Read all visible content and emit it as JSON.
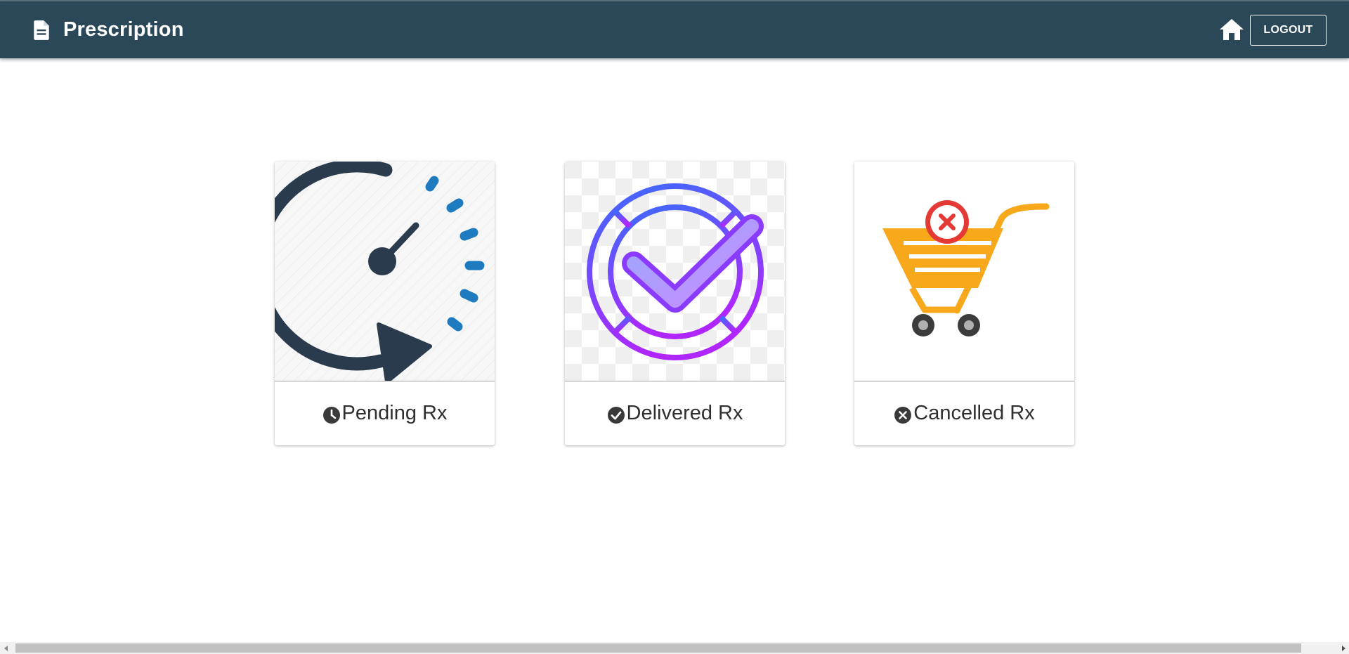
{
  "app": {
    "title": "Prescription",
    "title_icon": "document-icon",
    "theme_color": "#2a4858"
  },
  "header": {
    "home_icon": "home-icon",
    "logout_label": "LOGOUT"
  },
  "cards": [
    {
      "label": "Pending Rx",
      "label_icon": "clock-icon",
      "image": "speed-timer-image"
    },
    {
      "label": "Delivered Rx",
      "label_icon": "check-circle-icon",
      "image": "check-badge-image"
    },
    {
      "label": "Cancelled Rx",
      "label_icon": "x-circle-icon",
      "image": "cancel-cart-image"
    }
  ],
  "colors": {
    "pending_dark": "#2b3b4e",
    "pending_accent": "#1f7bbf",
    "delivered_start": "#3b6cff",
    "delivered_end": "#b026ff",
    "cart_orange": "#f8a81b",
    "cancel_red": "#e53935"
  }
}
